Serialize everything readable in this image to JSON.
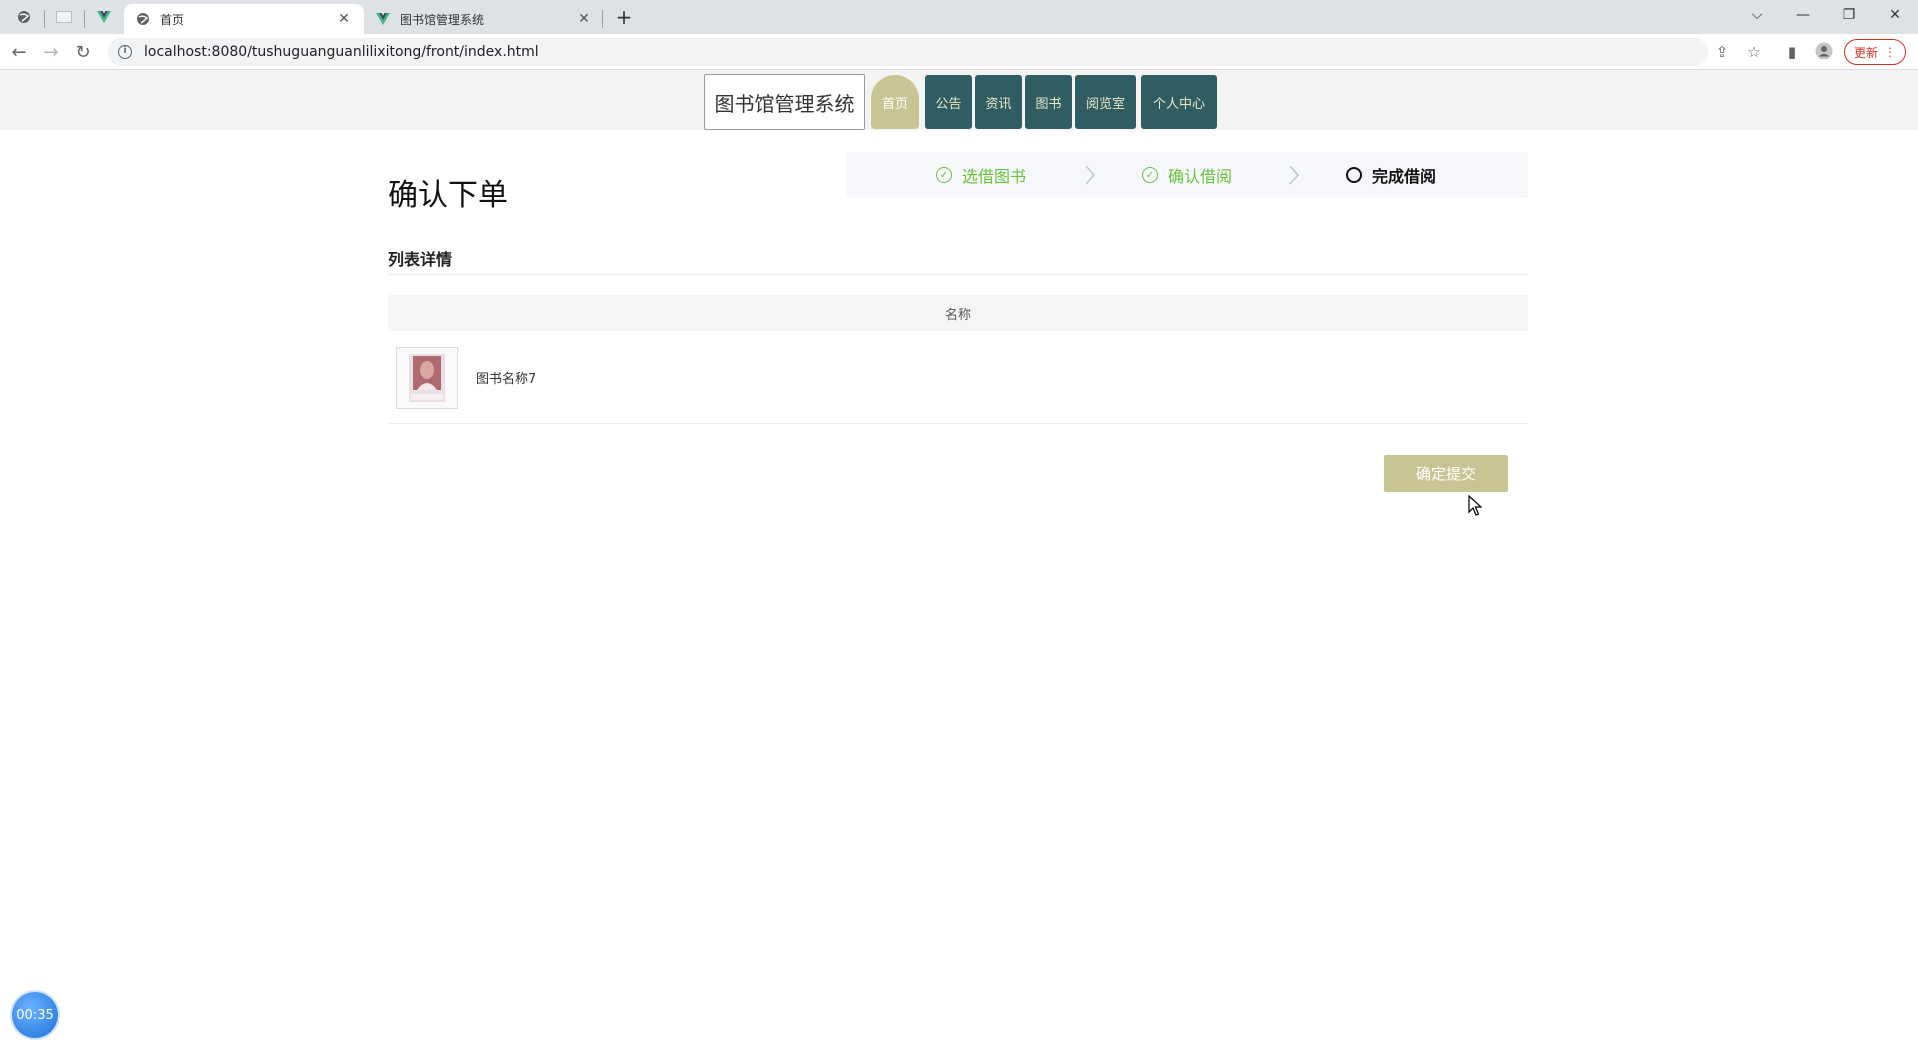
{
  "browser": {
    "tabs": [
      {
        "title": "首页",
        "active": true
      },
      {
        "title": "图书馆管理系统",
        "active": false
      }
    ],
    "url": "localhost:8080/tushuguanguanlilixitong/front/index.html",
    "update_label": "更新"
  },
  "site": {
    "logo": "图书馆管理系统",
    "nav": [
      "首页",
      "公告",
      "资讯",
      "图书",
      "阅览室",
      "个人中心"
    ]
  },
  "page": {
    "title": "确认下单",
    "steps": [
      {
        "label": "选借图书",
        "state": "done"
      },
      {
        "label": "确认借阅",
        "state": "done"
      },
      {
        "label": "完成借阅",
        "state": "current"
      }
    ],
    "section_title": "列表详情",
    "table": {
      "header": "名称",
      "rows": [
        {
          "name": "图书名称7"
        }
      ]
    },
    "submit_label": "确定提交"
  },
  "timer": "00:35",
  "colors": {
    "nav_bg": "#2f5d62",
    "accent": "#c8c493",
    "step_done": "#67c23a"
  }
}
